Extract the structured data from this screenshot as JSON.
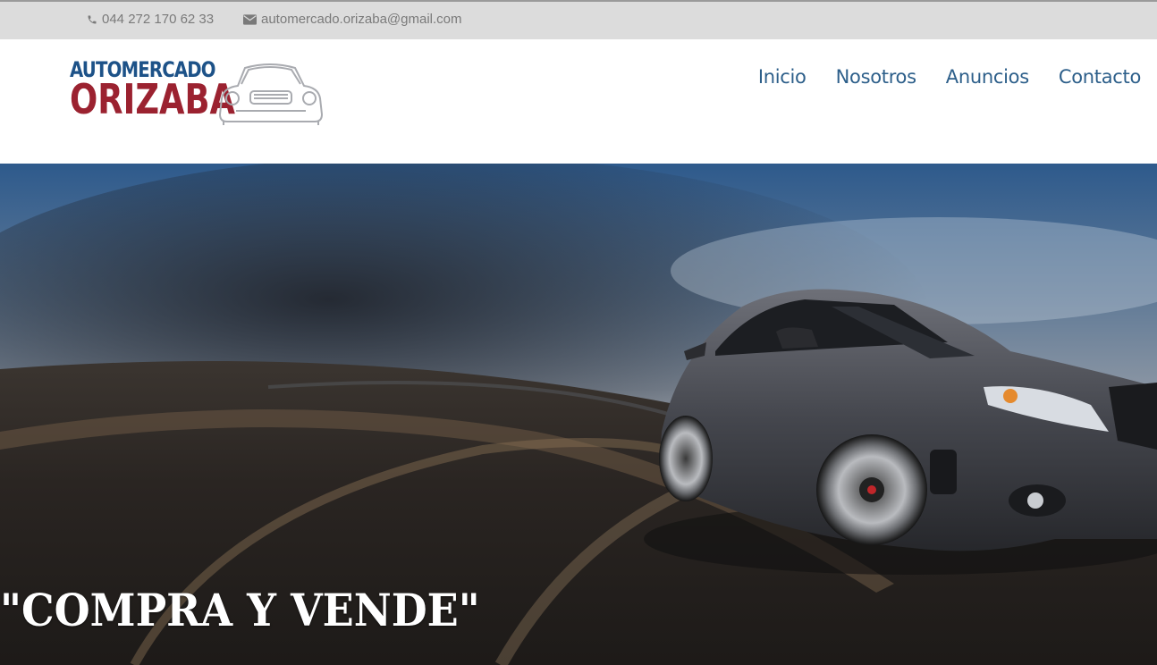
{
  "topbar": {
    "phone": "044 272 170 62 33",
    "email": "automercado.orizaba@gmail.com",
    "icons": {
      "phone": "phone-icon",
      "email": "envelope-icon"
    }
  },
  "logo": {
    "line1": "AUTOMERCADO",
    "line2": "ORIZABA"
  },
  "nav": {
    "items": [
      {
        "label": "Inicio"
      },
      {
        "label": "Nosotros"
      },
      {
        "label": "Anuncios"
      },
      {
        "label": "Contacto"
      }
    ]
  },
  "hero": {
    "title": "\"COMPRA Y VENDE\""
  },
  "colors": {
    "nav_text": "#2d5f8a",
    "logo_blue": "#1d5288",
    "logo_red": "#9b2230",
    "topbar_bg": "#dcdcdc"
  }
}
